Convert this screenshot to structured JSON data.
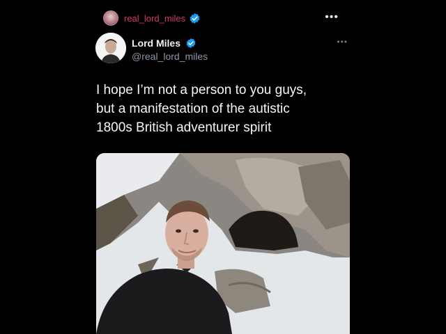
{
  "top_bar": {
    "username": "real_lord_miles",
    "more_label": "•••"
  },
  "tweet": {
    "display_name": "Lord Miles",
    "handle": "@real_lord_miles",
    "more_label": "•••",
    "text_lines": [
      "I hope I’m not a person to you guys,",
      "but a manifestation of the autistic",
      "1800s British adventurer spirit"
    ]
  },
  "colors": {
    "background": "#000000",
    "username_accent": "#d23a6b",
    "verified_blue": "#1d9bf0",
    "handle_gray": "#8b98a5"
  },
  "icons": {
    "top_verified": "verified-badge-icon",
    "tweet_verified": "verified-badge-icon"
  }
}
